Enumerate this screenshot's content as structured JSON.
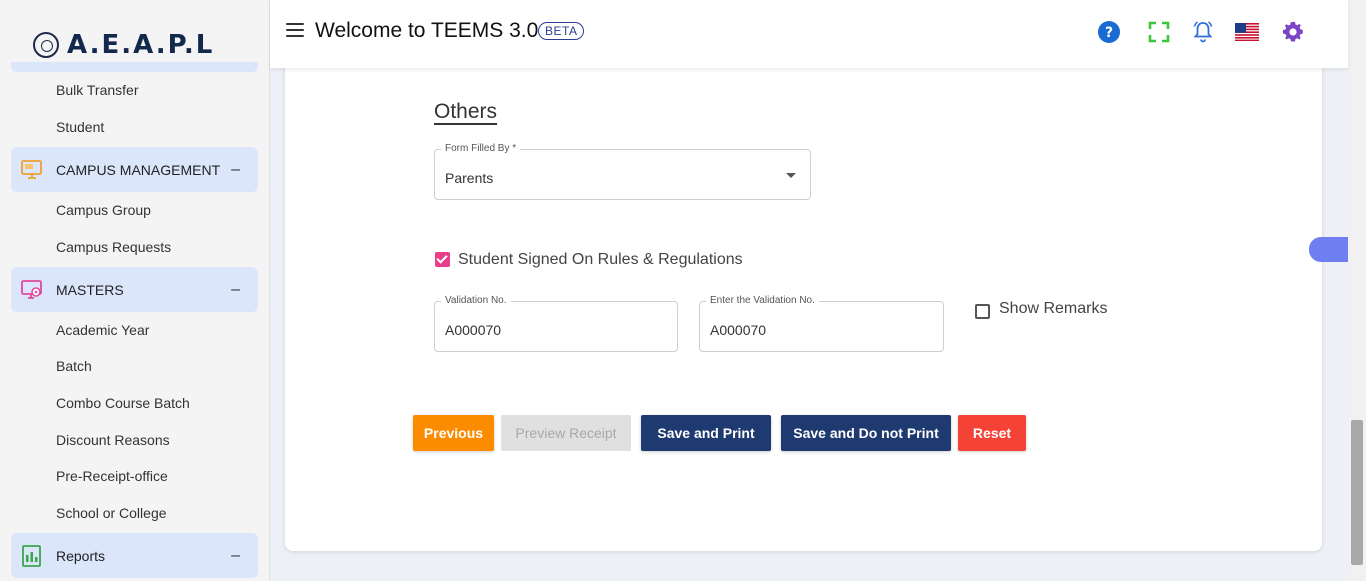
{
  "app": {
    "logo_text": "A.E.A.P.L",
    "title": "Welcome to TEEMS 3.0",
    "badge": "BETA"
  },
  "header_icons": [
    "help-icon",
    "fullscreen-icon",
    "notification-bell-icon",
    "us-flag-icon",
    "settings-gear-icon"
  ],
  "sidebar": {
    "top_items": [
      "Bulk Transfer",
      "Student"
    ],
    "groups": [
      {
        "label": "CAMPUS MANAGEMENT",
        "toggle": "–",
        "icon": "monitor-icon",
        "items": [
          "Campus Group",
          "Campus Requests"
        ]
      },
      {
        "label": "MASTERS",
        "toggle": "–",
        "icon": "monitor-settings-icon",
        "items": [
          "Academic Year",
          "Batch",
          "Combo Course Batch",
          "Discount Reasons",
          "Pre-Receipt-office",
          "School or College"
        ]
      },
      {
        "label": "Reports",
        "toggle": "–",
        "icon": "report-chart-icon",
        "items": []
      }
    ]
  },
  "form": {
    "section_title": "Others",
    "form_filled_by": {
      "label": "Form Filled By *",
      "value": "Parents"
    },
    "rules_checkbox": {
      "label": "Student Signed On Rules & Regulations",
      "checked": true
    },
    "validation_no": {
      "label": "Validation No.",
      "value": "A000070"
    },
    "enter_validation_no": {
      "label": "Enter the Validation No.",
      "value": "A000070"
    },
    "show_remarks": {
      "label": "Show Remarks",
      "checked": false
    }
  },
  "buttons": {
    "previous": "Previous",
    "preview_receipt": "Preview Receipt",
    "save_and_print": "Save and Print",
    "save_no_print": "Save and Do not Print",
    "reset": "Reset"
  },
  "colors": {
    "previous": "#fb8c00",
    "preview_disabled": "#e0e0e0",
    "primary": "#1e3a70",
    "reset": "#f44336",
    "checkbox": "#e83e8c",
    "sidebar_group_bg": "#dbe6fb",
    "side_tab": "#6f7ef0"
  }
}
